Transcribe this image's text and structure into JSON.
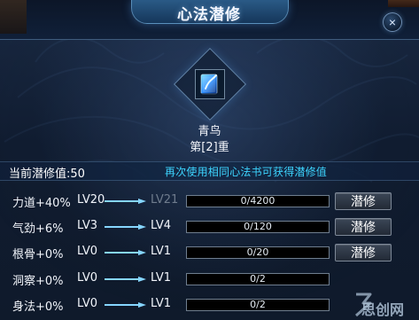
{
  "window": {
    "title": "心法潜修",
    "close_glyph": "×"
  },
  "book": {
    "name": "青鸟",
    "rank": "第[2]重",
    "icon": "book-icon"
  },
  "info": {
    "current_label": "当前潜修值:50",
    "hint": "再次使用相同心法书可获得潜修值"
  },
  "attributes": [
    {
      "stat": "力道+40%",
      "lv_current": "LV20",
      "lv_next": "LV21",
      "progress": "0/4200",
      "progress_fraction": 0.0,
      "button": "潜修"
    },
    {
      "stat": "气劲+6%",
      "lv_current": "LV3",
      "lv_next": "LV4",
      "progress": "0/120",
      "progress_fraction": 0.0,
      "button": "潜修"
    },
    {
      "stat": "根骨+0%",
      "lv_current": "LV0",
      "lv_next": "LV1",
      "progress": "0/20",
      "progress_fraction": 0.0,
      "button": "潜修"
    },
    {
      "stat": "洞察+0%",
      "lv_current": "LV0",
      "lv_next": "LV1",
      "progress": "0/2",
      "progress_fraction": 0.0,
      "button": ""
    },
    {
      "stat": "身法+0%",
      "lv_current": "LV0",
      "lv_next": "LV1",
      "progress": "0/2",
      "progress_fraction": 0.0,
      "button": ""
    }
  ],
  "watermark": {
    "text": "思创网"
  },
  "colors": {
    "hint": "#3dd5ff",
    "bar_fill": "#2f7cff",
    "dim_text": "#6f7c8d"
  }
}
